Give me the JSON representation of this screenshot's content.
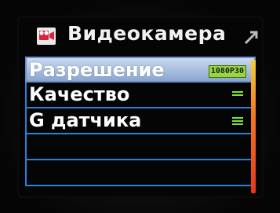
{
  "header": {
    "title": "Видеокамера",
    "icon": "video-camera-icon",
    "back_icon": "back-arrow-icon"
  },
  "menu": {
    "items": [
      {
        "label": "Разрешение",
        "value": "1080P30",
        "selected": true
      },
      {
        "label": "Качество",
        "value_indicator": "quality-level-icon",
        "selected": false
      },
      {
        "label": "G датчика",
        "value_indicator": "sensitivity-level-icon",
        "selected": false
      },
      {
        "label": "",
        "selected": false
      },
      {
        "label": "",
        "selected": false
      }
    ]
  },
  "colors": {
    "selection": "#9bb4dc",
    "row_border": "#2a7fd6",
    "badge_bg": "#9cd43a",
    "indicator": "#7fe23a",
    "scrollbar_top": "#f3d23a",
    "scrollbar_bottom": "#e8361c"
  }
}
